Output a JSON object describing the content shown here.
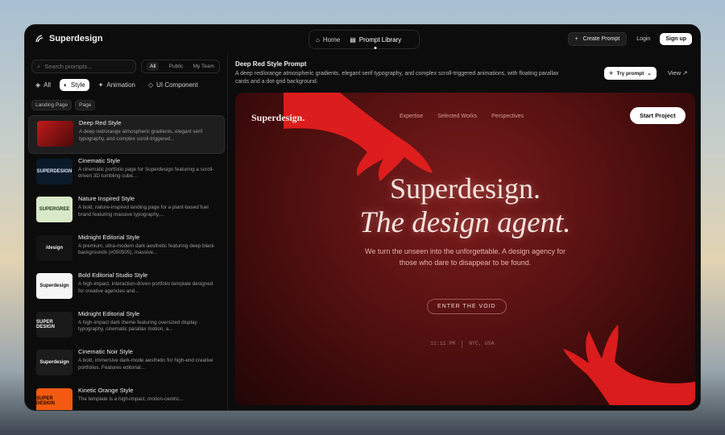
{
  "app": {
    "name": "Superdesign"
  },
  "nav": {
    "home": "Home",
    "library": "Prompt Library"
  },
  "actions": {
    "create": "Create Prompt",
    "login": "Login",
    "signup": "Sign up"
  },
  "sidebar": {
    "search_placeholder": "Search prompts...",
    "scope": [
      "All",
      "Public",
      "My Team"
    ],
    "categories": [
      "All",
      "Style",
      "Animation",
      "UI Component"
    ],
    "tags": [
      "Landing Page",
      "Page"
    ],
    "items": [
      {
        "title": "Deep Red Style",
        "desc": "A deep red/orange atmospheric gradients, elegant serif typography, and complex scroll-triggered..."
      },
      {
        "title": "Cinematic Style",
        "desc": "A cinematic portfolio page for Superdesign featuring a scroll-driven 3D tumbling cube..."
      },
      {
        "title": "Nature Inspired Style",
        "desc": "A bold, nature-inspired landing page for a plant-based fuel brand featuring massive typography,..."
      },
      {
        "title": "Midnight Editorial Style",
        "desc": "A premium, ultra-modern dark aesthetic featuring deep black backgrounds (#050505), massive..."
      },
      {
        "title": "Bold Editorial Studio Style",
        "desc": "A high-impact, interaction-driven portfolio template designed for creative agencies and..."
      },
      {
        "title": "Midnight Editorial Style",
        "desc": "A high-impact dark theme featuring oversized display typography, cinematic parallax motion, a..."
      },
      {
        "title": "Cinematic Noir Style",
        "desc": "A bold, immersive dark-mode aesthetic for high-end creative portfolios. Features editorial..."
      },
      {
        "title": "Kinetic Orange Style",
        "desc": "The template is a high-impact, motion-centric..."
      }
    ],
    "thumbs": [
      "",
      "SUPERDESIGN",
      "SUPERGREE",
      "/design",
      "Superdesign",
      "SUPER DESIGN",
      "Superdesign",
      "SUPER DESIGN"
    ]
  },
  "detail": {
    "title": "Deep Red Style Prompt",
    "desc": "A deep red/orange atmospheric gradients, elegant serif typography, and complex scroll-triggered animations, with floating parallax cards and a dot-grid background.",
    "try": "Try prompt",
    "view": "View"
  },
  "preview": {
    "logo": "Superdesign.",
    "nav": [
      "Expertise",
      "Selected Works",
      "Perspectives"
    ],
    "start": "Start Project",
    "headline1": "Superdesign.",
    "headline2": "The design agent.",
    "sub": "We turn the unseen into the unforgettable. A design agency for those who dare to disappear to be found.",
    "cta": "ENTER THE VOID",
    "time": "11:11 PM",
    "location": "NYC, USA"
  },
  "colors": {
    "accent_red": "#d82323",
    "bg": "#0c0c0d",
    "preview_bg": "#5a1212"
  }
}
